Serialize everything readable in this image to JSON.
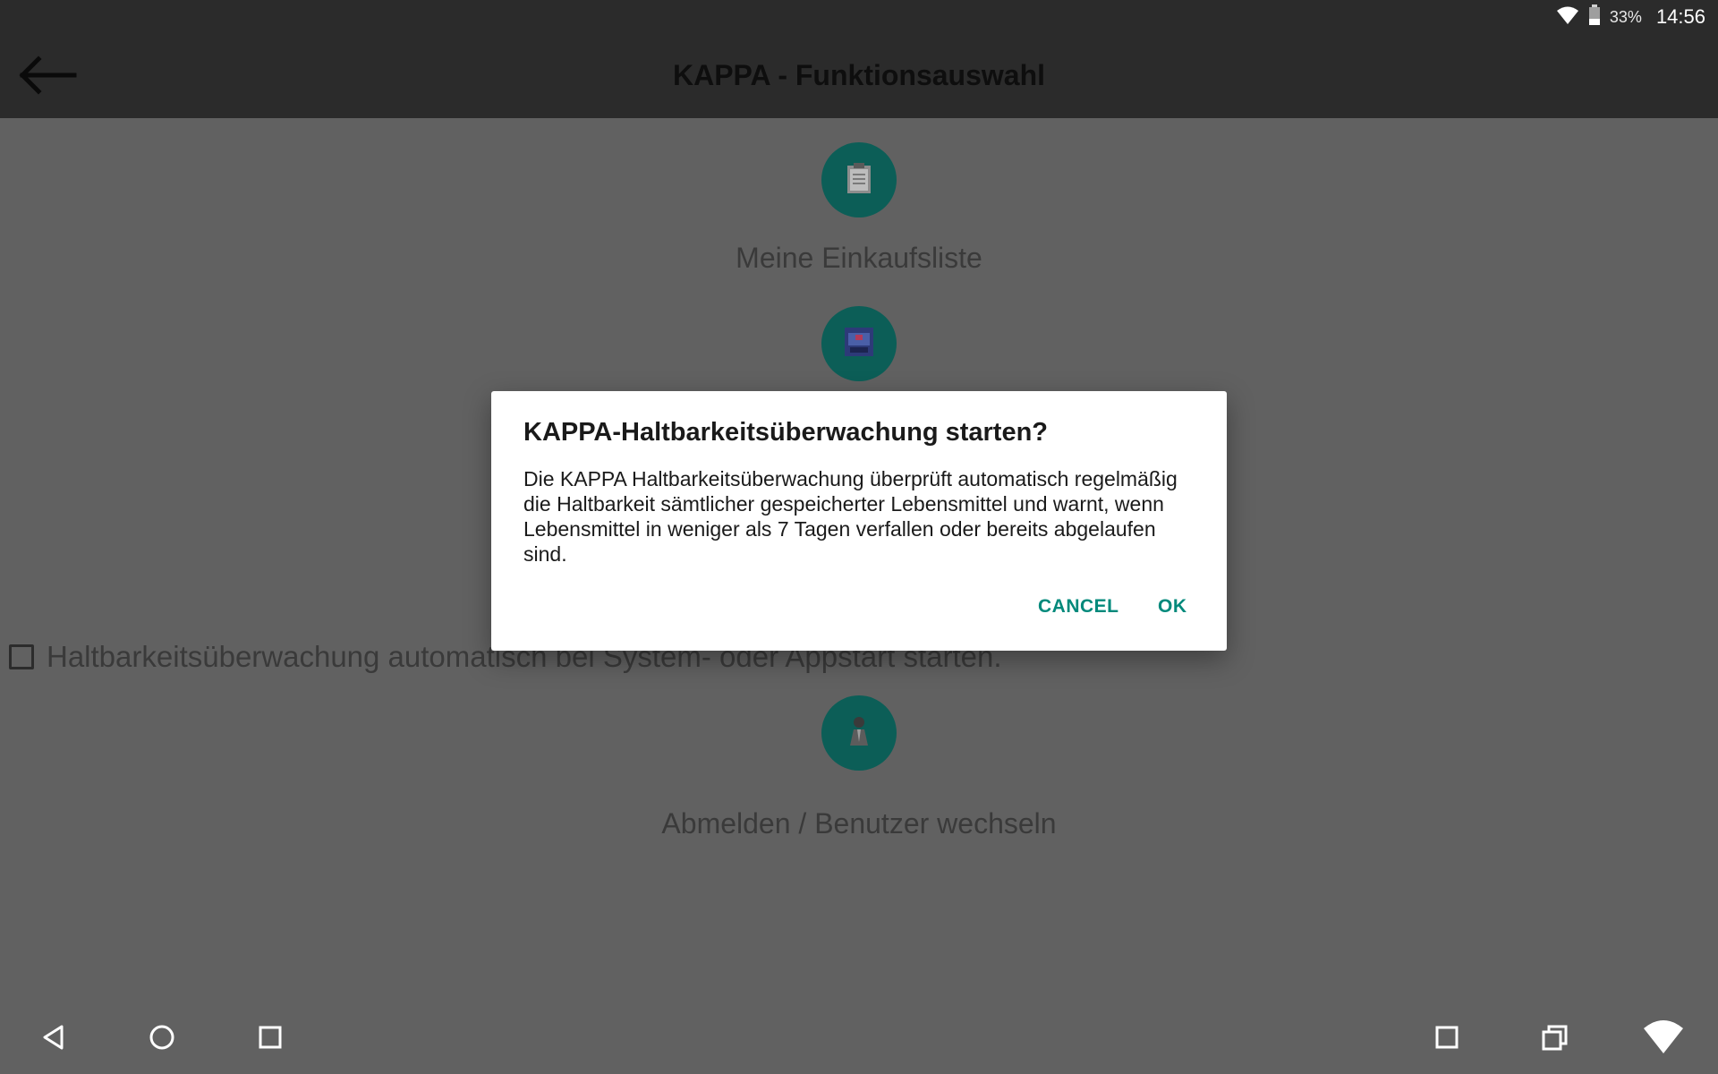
{
  "status_bar": {
    "battery_percent": "33%",
    "time": "14:56",
    "icons": [
      "wifi-icon",
      "battery-icon"
    ]
  },
  "app_bar": {
    "title": "KAPPA - Funktionsauswahl",
    "back_icon": "arrow-left-icon"
  },
  "functions": [
    {
      "label": "Meine Einkaufsliste",
      "icon": "clipboard-icon"
    },
    {
      "label": "",
      "icon": "monitor-icon"
    },
    {
      "label": "Abmelden / Benutzer wechseln",
      "icon": "user-icon"
    }
  ],
  "auto_start": {
    "checked": false,
    "label": "Haltbarkeitsüberwachung automatisch bei System- oder Appstart starten."
  },
  "dialog": {
    "title": "KAPPA-Haltbarkeitsüberwachung starten?",
    "message": "Die KAPPA Haltbarkeitsüberwachung überprüft automatisch regelmäßig die Haltbarkeit sämtlicher gespeicherter Lebensmittel und warnt, wenn Lebensmittel in weniger als 7 Tagen verfallen oder bereits abgelaufen sind.",
    "cancel_label": "CANCEL",
    "ok_label": "OK"
  },
  "nav_bar": {
    "items": [
      "back-icon",
      "home-icon",
      "recents-icon",
      "square-icon",
      "multi-window-icon",
      "wifi-icon"
    ]
  },
  "colors": {
    "accent": "#00897b",
    "icon_circle": "#0c5e57",
    "bar": "#2b2b2b",
    "scrim": "#616161"
  }
}
